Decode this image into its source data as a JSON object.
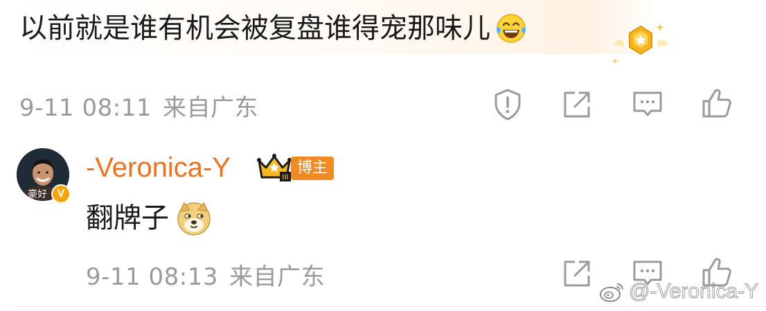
{
  "first_comment": {
    "text": "以前就是谁有机会被复盘谁得宠那味儿",
    "emoji": "laughing-tears-emoji",
    "badge": "gold-medal-badge",
    "date": "9-11 08:11",
    "location": "来自广东",
    "actions": [
      "report-icon",
      "share-icon",
      "comment-icon",
      "like-icon"
    ]
  },
  "reply": {
    "username": "-Veronica-Y",
    "avatar_caption": "豪好",
    "verified_mark": "V",
    "tag": "博主",
    "crown_level": "III",
    "text": "翻牌子",
    "emoji": "doge-emoji",
    "date": "9-11 08:13",
    "location": "来自广东",
    "actions": [
      "share-icon",
      "comment-icon",
      "like-icon"
    ]
  },
  "watermark": {
    "text": "@-Veronica-Y",
    "icon": "weibo-logo-icon"
  },
  "colors": {
    "username": "#f0731b",
    "meta_text": "#9a9a9a",
    "tag_bg": "#f08a24",
    "icon_gray": "#9a9a9a"
  }
}
